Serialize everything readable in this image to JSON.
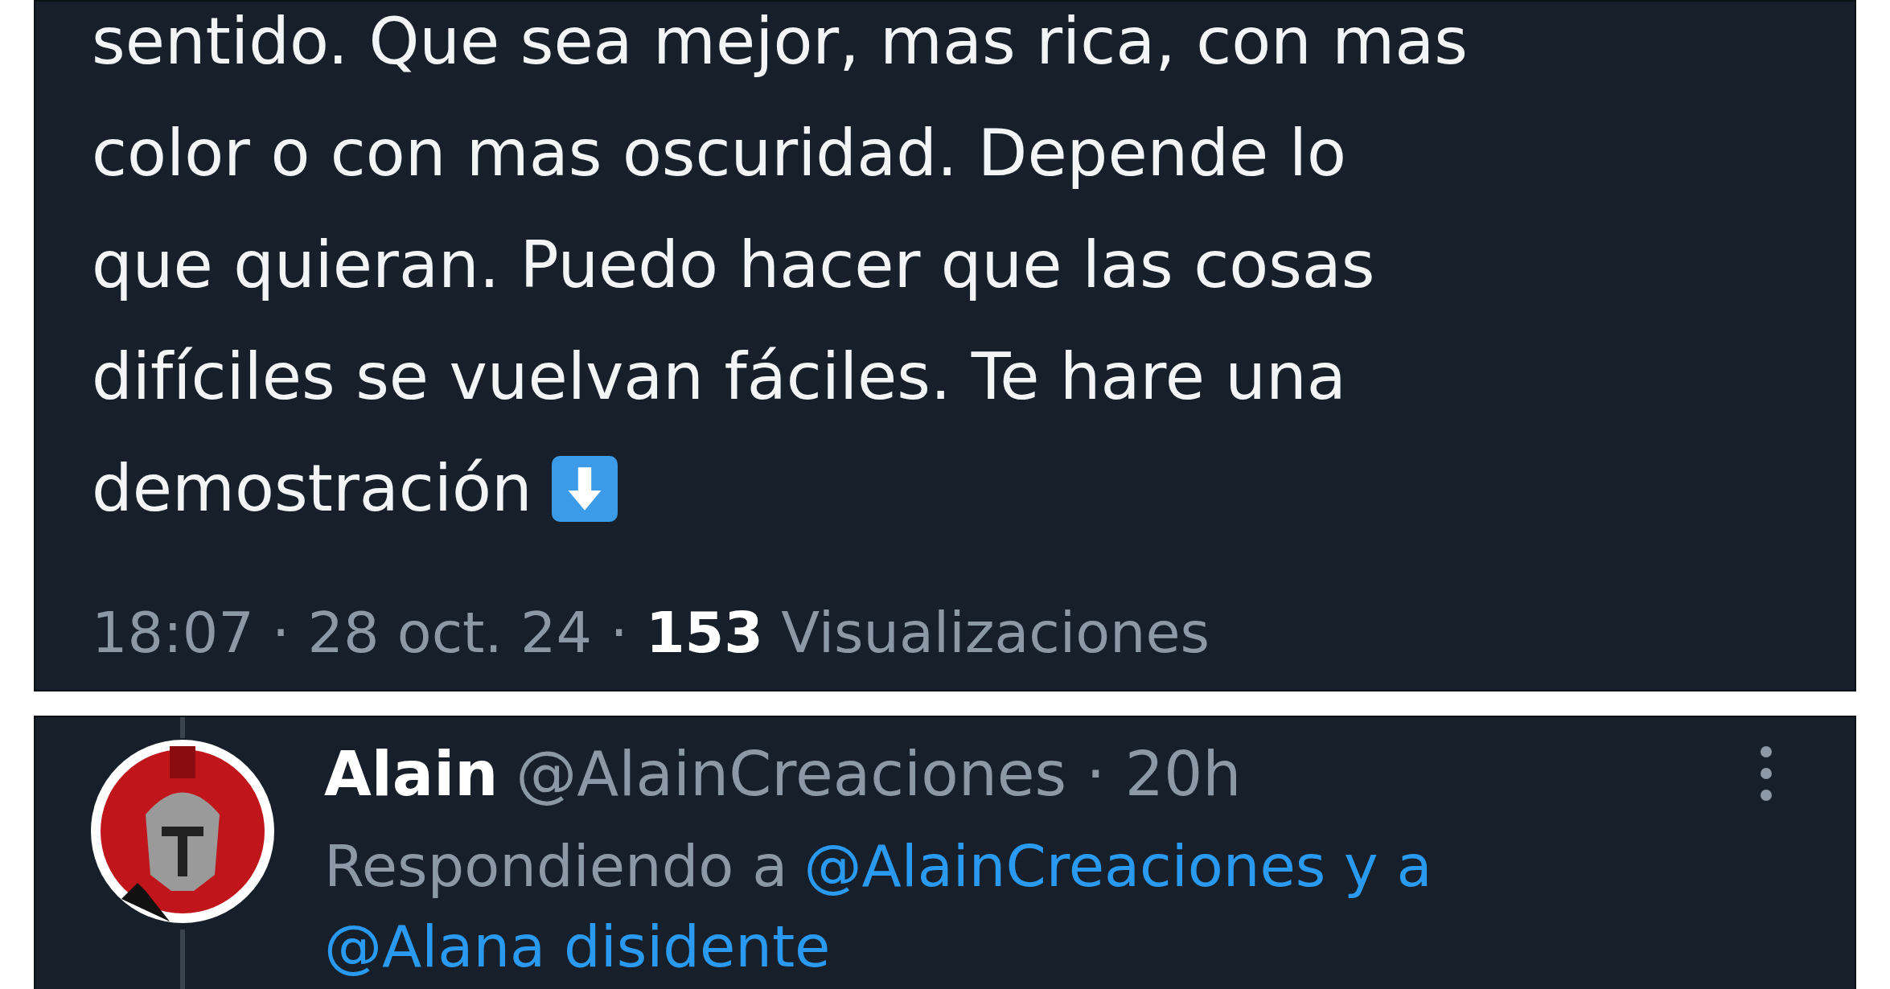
{
  "tweet": {
    "lines": [
      "sentido. Que sea mejor, mas rica, con mas",
      "color o con mas oscuridad. Depende lo",
      "que quieran. Puedo hacer que las cosas",
      "difíciles se vuelvan fáciles. Te hare una",
      "demostración"
    ],
    "meta": "18:07 · 28 oct. 24 · **153** Visualizaciones"
  },
  "reply": {
    "name": "Alain",
    "handle_time": "@AlainCreaciones · 20h",
    "replying_prefix": "Respondiendo a",
    "mentions": [
      "@AlainCreaciones y a",
      "@Alana disidente"
    ]
  }
}
